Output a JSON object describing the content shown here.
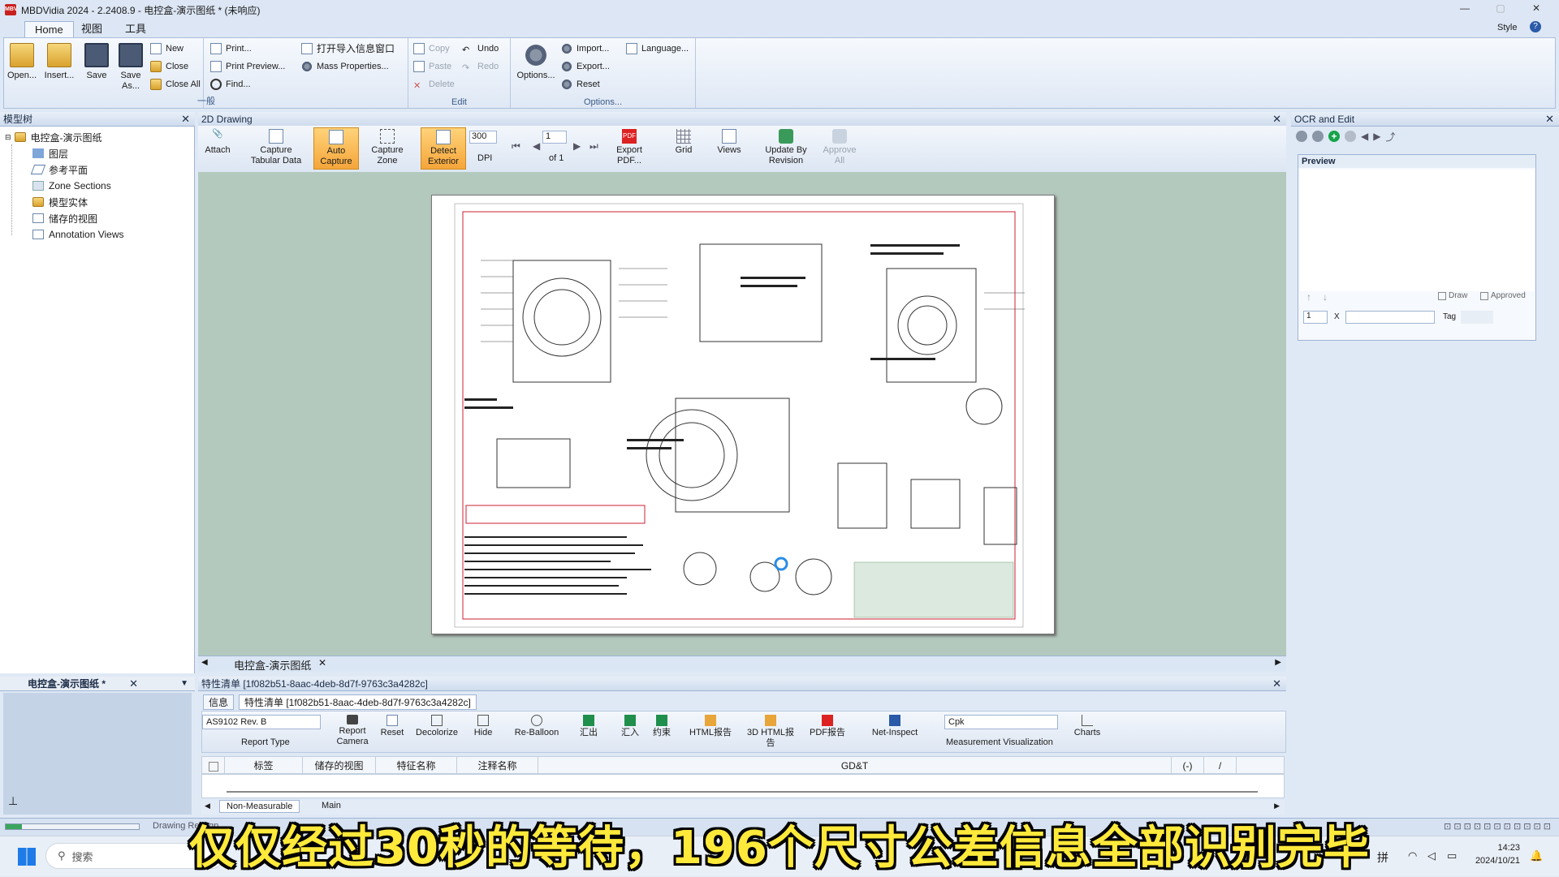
{
  "app": {
    "title": "MBDVidia 2024 - 2.2408.9 - 电控盒-演示图纸 * (未响应)",
    "style_label": "Style",
    "help_label": "?"
  },
  "menu_tabs": [
    "Home",
    "视图",
    "工具"
  ],
  "ribbon": {
    "file": {
      "open": "Open...",
      "insert": "Insert...",
      "save": "Save",
      "save_as": "Save As...",
      "new": "New",
      "close": "Close",
      "close_all": "Close All"
    },
    "print": {
      "print": "Print...",
      "preview": "Print Preview...",
      "find": "Find...",
      "import_window": "打开导入信息窗口",
      "mass": "Mass Properties..."
    },
    "group_general": "一般",
    "edit": {
      "copy": "Copy",
      "paste": "Paste",
      "delete": "Delete",
      "undo": "Undo",
      "redo": "Redo",
      "label": "Edit"
    },
    "options": {
      "options": "Options...",
      "import": "Import...",
      "export": "Export...",
      "reset": "Reset",
      "language": "Language...",
      "label": "Options..."
    }
  },
  "tree": {
    "header": "模型树",
    "root": "电控盒-演示图纸",
    "items": [
      "图层",
      "参考平面",
      "Zone Sections",
      "模型实体",
      "储存的视图",
      "Annotation Views"
    ],
    "lower_tab": "电控盒-演示图纸 *"
  },
  "drawing": {
    "header": "2D Drawing",
    "toolbar": {
      "attach": "Attach",
      "capture_tabular": "Capture Tabular Data",
      "auto_capture": "Auto Capture",
      "capture_zone": "Capture Zone",
      "detect_exterior": "Detect Exterior",
      "dpi_value": "300",
      "dpi_label": "DPI",
      "page_value": "1",
      "page_of": "of 1",
      "export_pdf": "Export PDF...",
      "grid": "Grid",
      "views": "Views",
      "update_by_revision": "Update By Revision",
      "approve_all": "Approve All"
    },
    "doc_tab": "电控盒-演示图纸"
  },
  "char_list": {
    "header": "特性清单 [1f082b51-8aac-4deb-8d7f-9763c3a4282c]",
    "tab_info": "信息",
    "tab_list": "特性清单 [1f082b51-8aac-4deb-8d7f-9763c3a4282c]",
    "report_type_value": "AS9102 Rev. B",
    "report_type_label": "Report Type",
    "buttons": [
      "Report Camera",
      "Reset",
      "Decolorize",
      "Hide",
      "Re-Balloon",
      "汇出",
      "汇入",
      "约束",
      "HTML报告",
      "3D HTML报告",
      "PDF报告",
      "Net-Inspect"
    ],
    "measurement_value": "Cpk",
    "measurement_label": "Measurement Visualization",
    "charts": "Charts",
    "columns": [
      "标签",
      "储存的视图",
      "特征名称",
      "注释名称",
      "GD&T",
      "(-)",
      "/"
    ],
    "bottom_tabs": [
      "Non-Measurable",
      "Main"
    ]
  },
  "ocr": {
    "header": "OCR and Edit",
    "preview": "Preview",
    "draw": "Draw",
    "approved": "Approved",
    "page_num": "1",
    "x_label": "X",
    "tag_label": "Tag"
  },
  "status": {
    "left": "Drawing Recogn"
  },
  "taskbar": {
    "search": "搜索",
    "ime": "拼",
    "time": "14:23",
    "date": "2024/10/21"
  },
  "subtitle": "仅仅经过30秒的等待，196个尺寸公差信息全部识别完毕"
}
